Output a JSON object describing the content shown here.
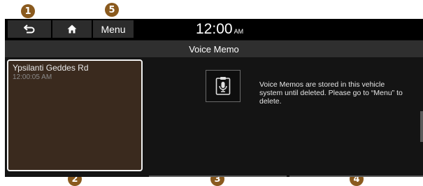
{
  "callouts": [
    "1",
    "2",
    "3",
    "4",
    "5"
  ],
  "header": {
    "back_icon": "back-arrow-icon",
    "home_icon": "home-icon",
    "menu_label": "Menu",
    "time": "12:00",
    "ampm": "AM"
  },
  "title": "Voice Memo",
  "memo_list": [
    {
      "title": "Ypsilanti Geddes Rd",
      "time": "12:00:05 AM"
    }
  ],
  "info": {
    "icon": "voice-memo-icon",
    "text": "Voice Memos are stored in this vehicle system until deleted. Please go to “Menu” to delete."
  },
  "controls": {
    "record_icon": "record-icon",
    "stop_icon": "stop-icon"
  },
  "colors": {
    "callout": "#8a5a1e",
    "selected_item_bg": "#3a2a1e",
    "record_dot": "#e01e1e"
  }
}
